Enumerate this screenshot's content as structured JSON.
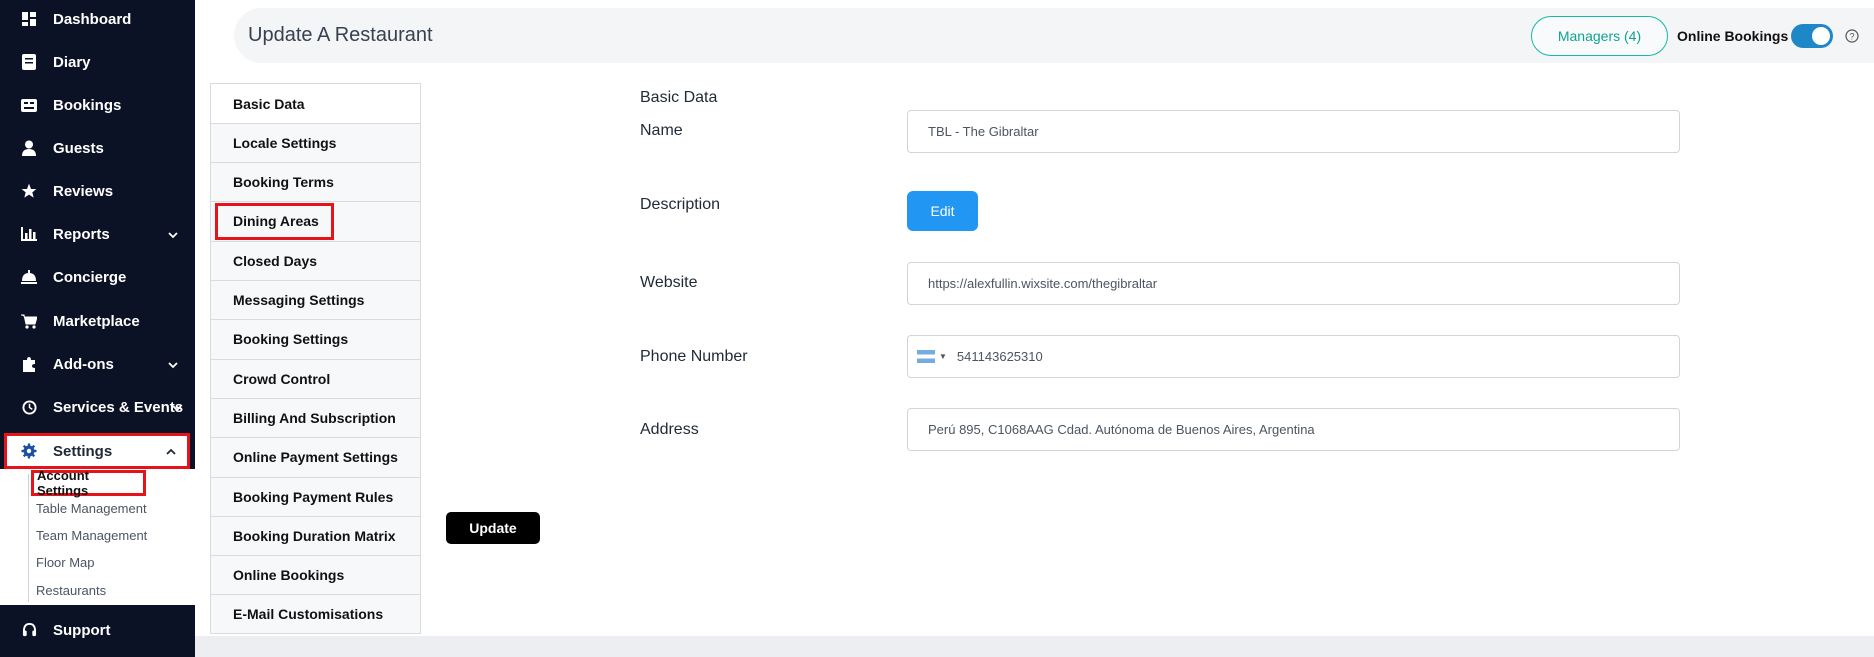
{
  "sidebar": {
    "items": [
      {
        "label": "Dashboard",
        "icon": "dashboard-icon"
      },
      {
        "label": "Diary",
        "icon": "diary-icon"
      },
      {
        "label": "Bookings",
        "icon": "bookings-icon"
      },
      {
        "label": "Guests",
        "icon": "guests-icon"
      },
      {
        "label": "Reviews",
        "icon": "star-icon"
      },
      {
        "label": "Reports",
        "icon": "chart-icon"
      },
      {
        "label": "Concierge",
        "icon": "concierge-icon"
      },
      {
        "label": "Marketplace",
        "icon": "cart-icon"
      },
      {
        "label": "Add-ons",
        "icon": "puzzle-icon"
      },
      {
        "label": "Services & Events",
        "icon": "clock-icon"
      },
      {
        "label": "Settings",
        "icon": "gear-icon"
      },
      {
        "label": "Support",
        "icon": "headset-icon"
      }
    ],
    "settings_submenu": [
      "Account Settings",
      "Table Management",
      "Team Management",
      "Floor Map",
      "Restaurants"
    ]
  },
  "header": {
    "title": "Update A Restaurant",
    "managers_button": "Managers (4)",
    "online_bookings_label": "Online Bookings",
    "online_bookings_enabled": true
  },
  "tabs": [
    "Basic Data",
    "Locale Settings",
    "Booking Terms",
    "Dining Areas",
    "Closed Days",
    "Messaging Settings",
    "Booking Settings",
    "Crowd Control",
    "Billing And Subscription",
    "Online Payment Settings",
    "Booking Payment Rules",
    "Booking Duration Matrix",
    "Online Bookings",
    "E-Mail Customisations"
  ],
  "form": {
    "section_title": "Basic Data",
    "name_label": "Name",
    "name_value": "TBL - The Gibraltar",
    "description_label": "Description",
    "edit_button": "Edit",
    "website_label": "Website",
    "website_value": "https://alexfullin.wixsite.com/thegibraltar",
    "phone_label": "Phone Number",
    "phone_value": "541143625310",
    "address_label": "Address",
    "address_value": "Perú 895, C1068AAG Cdad. Autónoma de Buenos Aires, Argentina",
    "update_button": "Update"
  },
  "colors": {
    "sidebar_bg": "#0c1226",
    "highlight": "#e5141b",
    "primary": "#2196f3",
    "teal": "#14b8a6",
    "toggle": "#1e88c7"
  }
}
